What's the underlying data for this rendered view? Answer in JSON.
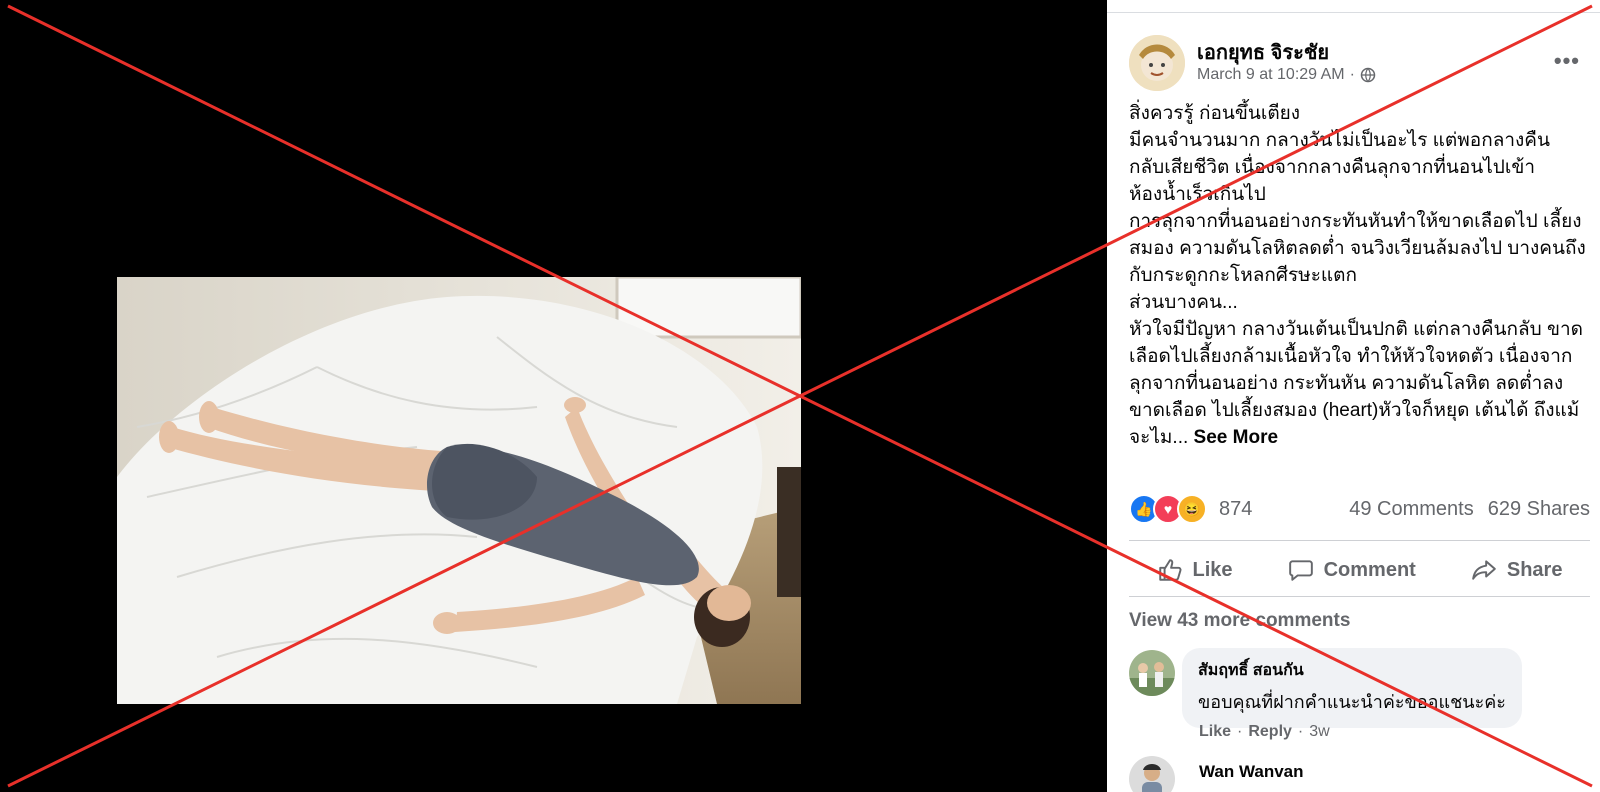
{
  "post": {
    "author": "เอกยุทธ จิระชัย",
    "timestamp": "March 9 at 10:29 AM",
    "separator": "·",
    "text": "สิ่งควรรู้ ก่อนขึ้นเตียง\nมีคนจำนวนมาก กลางวันไม่เป็นอะไร แต่พอกลางคืน กลับเสียชีวิต เนื่องจากกลางคืนลุกจากที่นอนไปเข้า ห้องน้ำเร็วเกินไป\nการลุกจากที่นอนอย่างกระทันหันทำให้ขาดเลือดไป เลี้ยงสมอง ความดันโลหิตลดต่ำ จนวิงเวียนล้มลงไป บางคนถึงกับกระดูกกะโหลกศีรษะแตก\nส่วนบางคน...\nหัวใจมีปัญหา กลางวันเต้นเป็นปกติ แต่กลางคืนกลับ ขาดเลือดไปเลี้ยงกล้ามเนื้อหัวใจ ทำให้หัวใจหดตัว เนื่องจากลุกจากที่นอนอย่าง กระทันหัน ความดันโลหิต ลดต่ำลงขาดเลือด ไปเลี้ยงสมอง (heart)หัวใจก็หยุด เต้นได้ ถึงแม้จะไม... ",
    "see_more": "See More",
    "more_options": "•••"
  },
  "stats": {
    "reaction_count": "874",
    "comments": "49 Comments",
    "shares": "629 Shares"
  },
  "actions": {
    "like": "Like",
    "comment": "Comment",
    "share": "Share"
  },
  "comments": {
    "view_more": "View 43 more comments",
    "items": [
      {
        "name": "สัมฤทธิ์ สอนกัน",
        "text": "ขอบคุณที่ฝากคำแนะนำค่ะขออแชนะค่ะ",
        "like": "Like",
        "reply": "Reply",
        "dot": "·",
        "age": "3w"
      },
      {
        "name": "Wan Wanvan"
      }
    ]
  },
  "colors": {
    "overlay_x": "#e8302a",
    "facebook_blue": "#1877f2",
    "muted_text": "#65676b"
  },
  "icons": {
    "privacy": "globe-icon",
    "like": "thumbs-up-icon",
    "comment": "speech-bubble-icon",
    "share": "share-arrow-icon"
  }
}
